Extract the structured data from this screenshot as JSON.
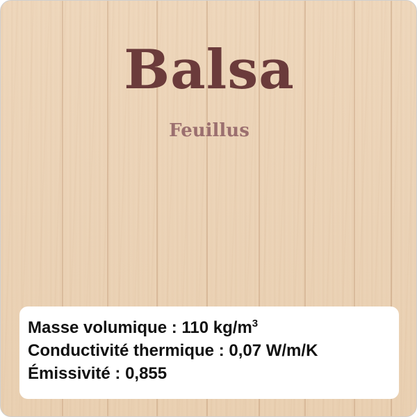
{
  "header": {
    "title": "Balsa",
    "subtitle": "Feuillus"
  },
  "properties": {
    "density_label": "Masse volumique",
    "density_value": "110 kg/m",
    "density_exponent": "3",
    "conductivity_label": "Conductivité thermique",
    "conductivity_value": "0,07 W/m/K",
    "emissivity_label": "Émissivité",
    "emissivity_value": "0,855",
    "separator": " : "
  },
  "colors": {
    "title": "#6b3b3b",
    "subtitle": "#9b6f6f",
    "wood_base": "#ecd4b8",
    "info_background": "#ffffff",
    "info_text": "#111111"
  }
}
